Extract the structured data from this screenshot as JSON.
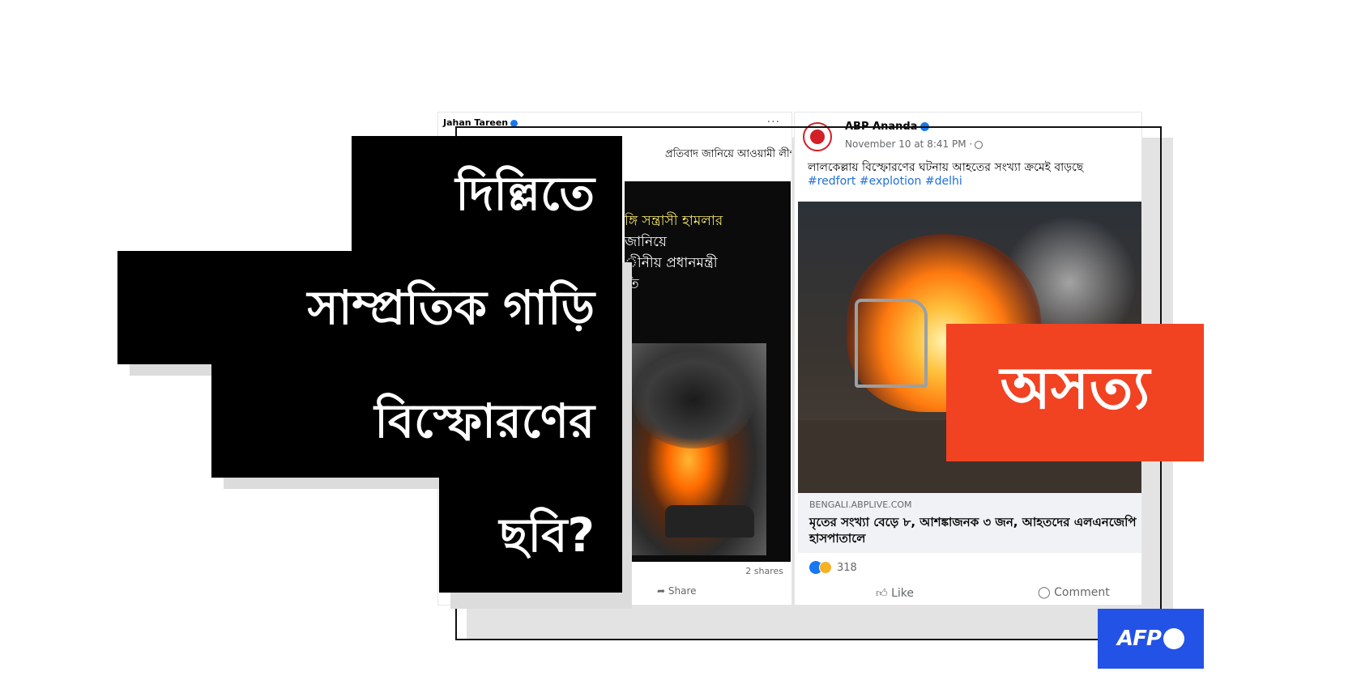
{
  "left_post": {
    "author": "Jahan Tareen",
    "text": "প্রতিবাদ জানিয়ে আওয়ামী লীগ",
    "image_lines": [
      "ঙ্গি সন্ত্রাসী হামলার",
      "জানিয়ে",
      "ীনীয় প্রধানমন্ত্রী",
      "তি"
    ],
    "shares": "2 shares",
    "share_label": "Share"
  },
  "right_post": {
    "page_name": "ABP Ananda",
    "date": "November 10 at 8:41 PM ·",
    "text": "লালকেল্লায় বিস্ফোরণের ঘটনায় আহতের সংখ্যা ক্রমেই বাড়ছে",
    "hashtags": "#redfort #explotion #delhi",
    "link_domain": "BENGALI.ABPLIVE.COM",
    "link_headline": "মৃতের সংখ্যা বেড়ে ৮, আশঙ্কাজনক ৩ জন, আহতদের এলএনজেপি হাসপাতালে",
    "reaction_count": "318",
    "like_label": "Like",
    "comment_label": "Comment"
  },
  "headline": {
    "line1": "দিল্লিতে",
    "line2": "সাম্প্রতিক গাড়ি",
    "line3": "বিস্ফোরণের",
    "line4": "ছবি?"
  },
  "verdict": "অসত্য",
  "brand": {
    "logo_text": "AFP",
    "color": "#2352e6"
  },
  "colors": {
    "verdict_bg": "#f14222",
    "headline_bg": "#000000",
    "hashtag": "#216fdb"
  }
}
